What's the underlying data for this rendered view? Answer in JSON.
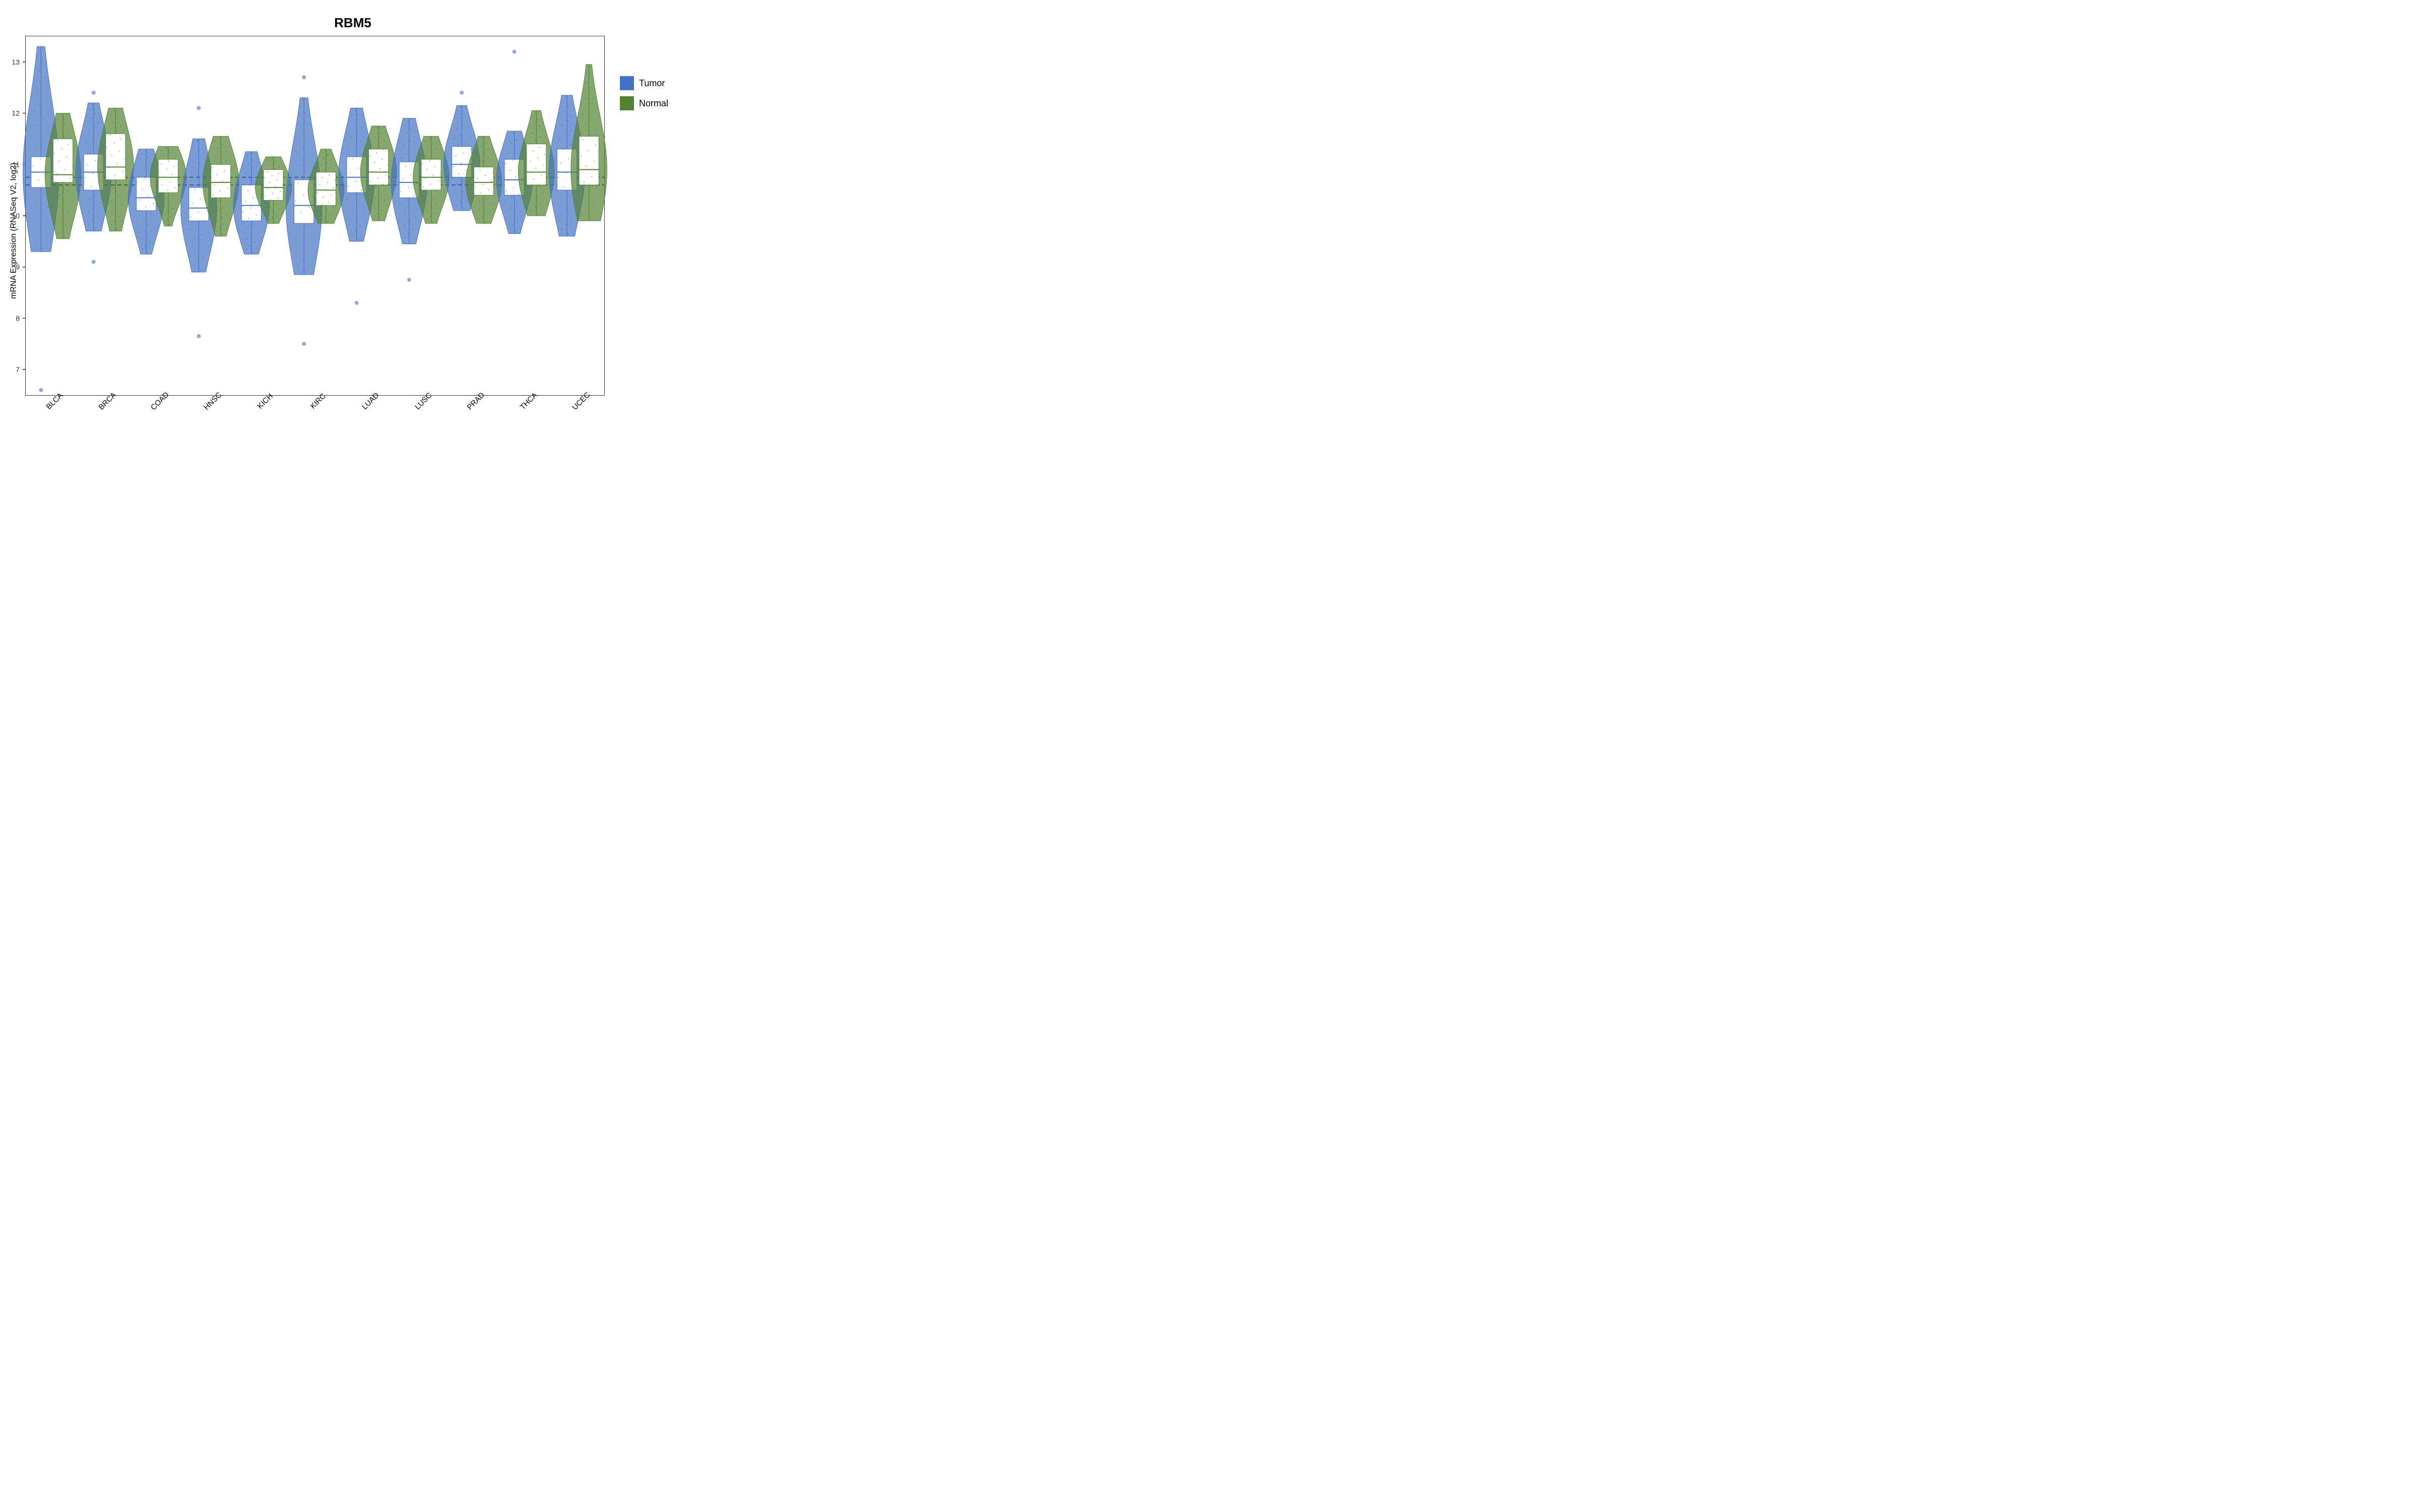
{
  "title": "RBM5",
  "y_axis_label": "mRNA Expression (RNASeq V2, log2)",
  "y_range": {
    "min": 6.5,
    "max": 13.5
  },
  "y_ticks": [
    7,
    8,
    9,
    10,
    11,
    12,
    13
  ],
  "dashed_lines": [
    10.6,
    10.75
  ],
  "x_labels": [
    "BLCA",
    "BRCA",
    "COAD",
    "HNSC",
    "KICH",
    "KIRC",
    "LUAD",
    "LUSC",
    "PRAD",
    "THCA",
    "UCEC"
  ],
  "legend": {
    "items": [
      {
        "label": "Tumor",
        "color": "#4472C4"
      },
      {
        "label": "Normal",
        "color": "#548235"
      }
    ]
  },
  "violins": [
    {
      "cancer": "BLCA",
      "tumor": {
        "center": 10.85,
        "width": 1.6,
        "peak_half_width": 0.6,
        "q1": 10.55,
        "q3": 11.15,
        "whisker_low": 9.3,
        "whisker_high": 13.3,
        "outliers_low": [
          6.6
        ],
        "outliers_high": []
      },
      "normal": {
        "center": 10.8,
        "width": 1.2,
        "peak_half_width": 0.45,
        "q1": 10.65,
        "q3": 11.5,
        "whisker_low": 9.55,
        "whisker_high": 12.0,
        "outliers_low": [],
        "outliers_high": []
      }
    },
    {
      "cancer": "BRCA",
      "tumor": {
        "center": 10.85,
        "width": 1.6,
        "peak_half_width": 0.5,
        "q1": 10.5,
        "q3": 11.2,
        "whisker_low": 9.7,
        "whisker_high": 12.2,
        "outliers_low": [
          9.1
        ],
        "outliers_high": [
          12.4
        ]
      },
      "normal": {
        "center": 10.95,
        "width": 1.3,
        "peak_half_width": 0.5,
        "q1": 10.7,
        "q3": 11.6,
        "whisker_low": 9.7,
        "whisker_high": 12.1,
        "outliers_low": [],
        "outliers_high": []
      }
    },
    {
      "cancer": "COAD",
      "tumor": {
        "center": 10.35,
        "width": 1.3,
        "peak_half_width": 0.5,
        "q1": 10.1,
        "q3": 10.75,
        "whisker_low": 9.25,
        "whisker_high": 11.3,
        "outliers_low": [],
        "outliers_high": []
      },
      "normal": {
        "center": 10.75,
        "width": 1.2,
        "peak_half_width": 0.45,
        "q1": 10.45,
        "q3": 11.1,
        "whisker_low": 9.8,
        "whisker_high": 11.35,
        "outliers_low": [],
        "outliers_high": []
      }
    },
    {
      "cancer": "HNSC",
      "tumor": {
        "center": 10.15,
        "width": 1.4,
        "peak_half_width": 0.5,
        "q1": 9.9,
        "q3": 10.55,
        "whisker_low": 8.9,
        "whisker_high": 11.5,
        "outliers_low": [
          7.65
        ],
        "outliers_high": [
          12.1
        ]
      },
      "normal": {
        "center": 10.65,
        "width": 1.1,
        "peak_half_width": 0.4,
        "q1": 10.35,
        "q3": 11.0,
        "whisker_low": 9.6,
        "whisker_high": 11.55,
        "outliers_low": [],
        "outliers_high": []
      }
    },
    {
      "cancer": "KICH",
      "tumor": {
        "center": 10.2,
        "width": 1.1,
        "peak_half_width": 0.4,
        "q1": 9.9,
        "q3": 10.6,
        "whisker_low": 9.25,
        "whisker_high": 11.25,
        "outliers_low": [],
        "outliers_high": []
      },
      "normal": {
        "center": 10.55,
        "width": 1.0,
        "peak_half_width": 0.38,
        "q1": 10.3,
        "q3": 10.9,
        "whisker_low": 9.85,
        "whisker_high": 11.15,
        "outliers_low": [],
        "outliers_high": []
      }
    },
    {
      "cancer": "KIRC",
      "tumor": {
        "center": 10.2,
        "width": 1.5,
        "peak_half_width": 0.55,
        "q1": 9.85,
        "q3": 10.7,
        "whisker_low": 8.85,
        "whisker_high": 12.3,
        "outliers_low": [
          7.5
        ],
        "outliers_high": [
          12.7
        ]
      },
      "normal": {
        "center": 10.5,
        "width": 1.1,
        "peak_half_width": 0.4,
        "q1": 10.2,
        "q3": 10.85,
        "whisker_low": 9.85,
        "whisker_high": 11.3,
        "outliers_low": [],
        "outliers_high": []
      }
    },
    {
      "cancer": "LUAD",
      "tumor": {
        "center": 10.75,
        "width": 1.4,
        "peak_half_width": 0.5,
        "q1": 10.45,
        "q3": 11.15,
        "whisker_low": 9.5,
        "whisker_high": 12.1,
        "outliers_low": [
          8.3
        ],
        "outliers_high": []
      },
      "normal": {
        "center": 10.85,
        "width": 1.2,
        "peak_half_width": 0.45,
        "q1": 10.6,
        "q3": 11.3,
        "whisker_low": 9.9,
        "whisker_high": 11.75,
        "outliers_low": [],
        "outliers_high": []
      }
    },
    {
      "cancer": "LUSC",
      "tumor": {
        "center": 10.65,
        "width": 1.4,
        "peak_half_width": 0.5,
        "q1": 10.35,
        "q3": 11.05,
        "whisker_low": 9.45,
        "whisker_high": 11.9,
        "outliers_low": [
          8.75
        ],
        "outliers_high": []
      },
      "normal": {
        "center": 10.75,
        "width": 1.1,
        "peak_half_width": 0.4,
        "q1": 10.5,
        "q3": 11.1,
        "whisker_low": 9.85,
        "whisker_high": 11.55,
        "outliers_low": [],
        "outliers_high": []
      }
    },
    {
      "cancer": "PRAD",
      "tumor": {
        "center": 11.0,
        "width": 1.3,
        "peak_half_width": 0.45,
        "q1": 10.75,
        "q3": 11.35,
        "whisker_low": 10.1,
        "whisker_high": 12.15,
        "outliers_low": [],
        "outliers_high": [
          12.4
        ]
      },
      "normal": {
        "center": 10.65,
        "width": 1.1,
        "peak_half_width": 0.4,
        "q1": 10.4,
        "q3": 10.95,
        "whisker_low": 9.85,
        "whisker_high": 11.55,
        "outliers_low": [],
        "outliers_high": []
      }
    },
    {
      "cancer": "THCA",
      "tumor": {
        "center": 10.7,
        "width": 1.3,
        "peak_half_width": 0.5,
        "q1": 10.4,
        "q3": 11.1,
        "whisker_low": 9.65,
        "whisker_high": 11.65,
        "outliers_low": [],
        "outliers_high": [
          13.2
        ]
      },
      "normal": {
        "center": 10.85,
        "width": 1.2,
        "peak_half_width": 0.45,
        "q1": 10.6,
        "q3": 11.4,
        "whisker_low": 10.0,
        "whisker_high": 12.05,
        "outliers_low": [],
        "outliers_high": []
      }
    },
    {
      "cancer": "UCEC",
      "tumor": {
        "center": 10.85,
        "width": 1.5,
        "peak_half_width": 0.55,
        "q1": 10.5,
        "q3": 11.3,
        "whisker_low": 9.6,
        "whisker_high": 12.35,
        "outliers_low": [],
        "outliers_high": []
      },
      "normal": {
        "center": 10.9,
        "width": 1.4,
        "peak_half_width": 0.52,
        "q1": 10.6,
        "q3": 11.55,
        "whisker_low": 9.9,
        "whisker_high": 12.95,
        "outliers_low": [],
        "outliers_high": []
      }
    }
  ],
  "colors": {
    "tumor": "#4472C4",
    "normal": "#548235",
    "tumor_fill": "rgba(68,114,196,0.7)",
    "normal_fill": "rgba(84,130,53,0.7)"
  }
}
